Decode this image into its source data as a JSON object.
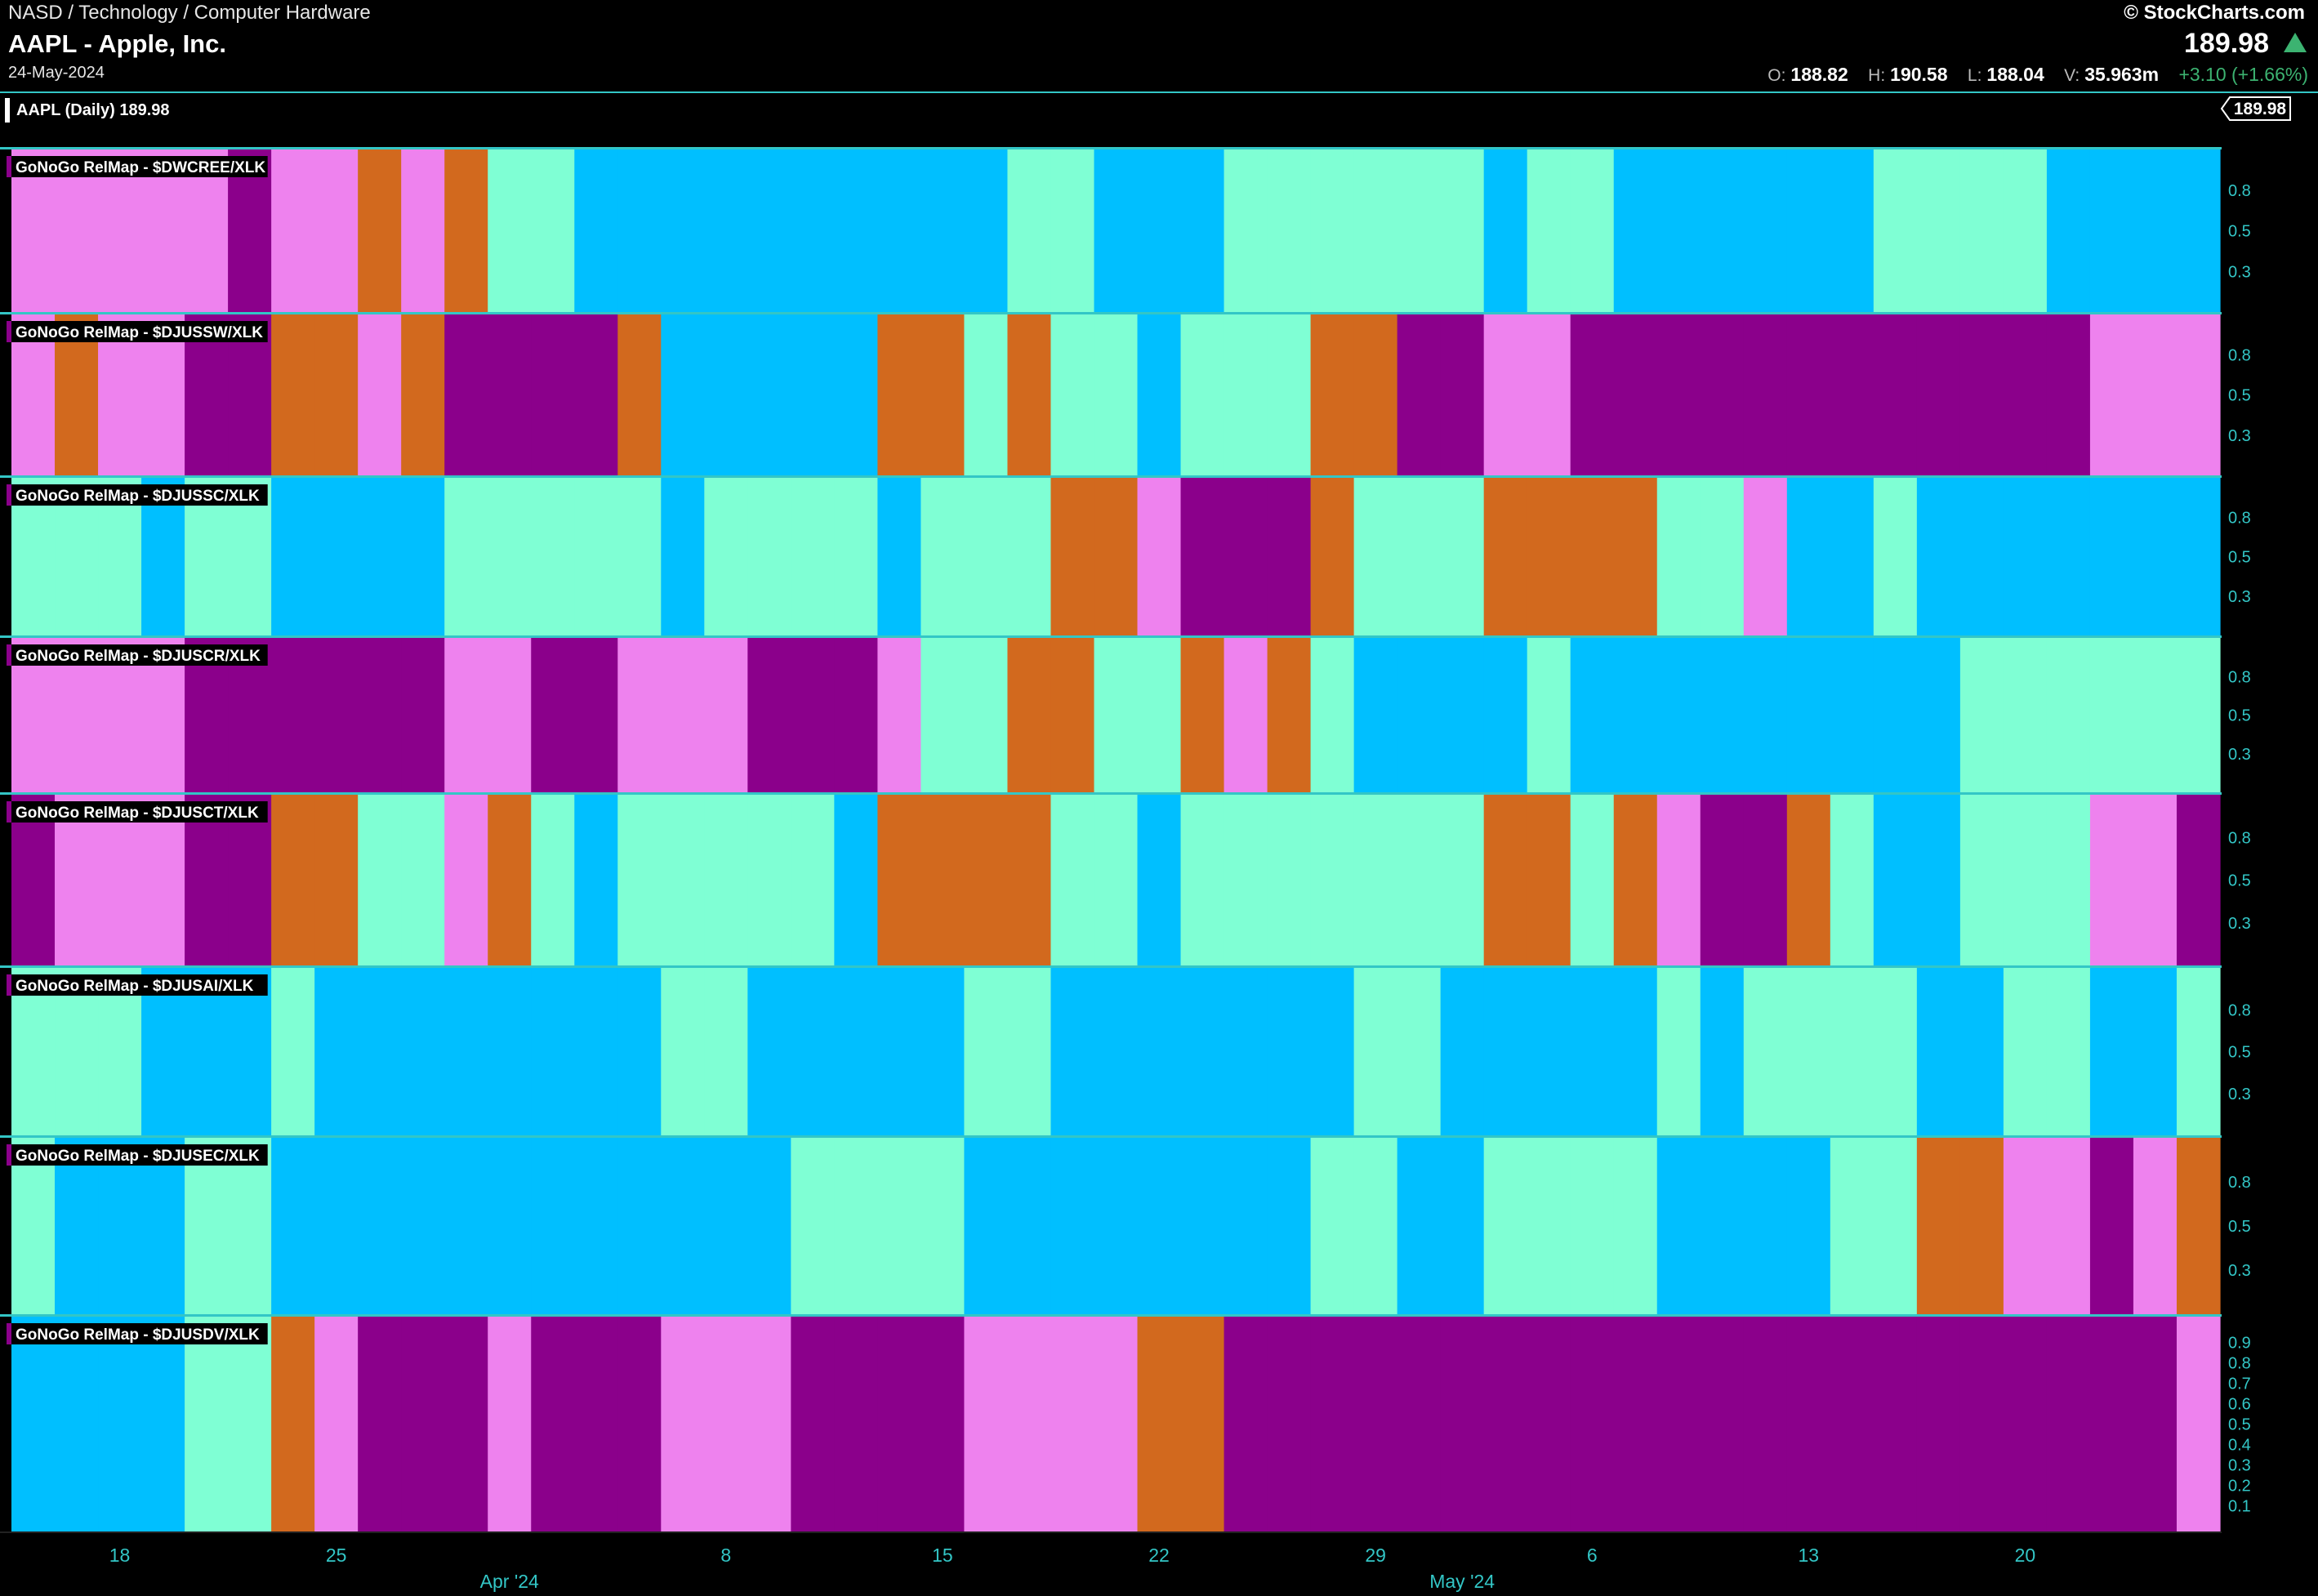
{
  "header": {
    "breadcrumb": "NASD / Technology / Computer Hardware",
    "title": "AAPL - Apple, Inc.",
    "date": "24-May-2024",
    "brand": "© StockCharts.com",
    "price": "189.98",
    "ohlc": {
      "o_label": "O:",
      "o": "188.82",
      "h_label": "H:",
      "h": "190.58",
      "l_label": "L:",
      "l": "188.04",
      "v_label": "V:",
      "v": "35.963m",
      "change": "+3.10 (+1.66%)"
    },
    "change_color": "#3cb371"
  },
  "main_legend": "AAPL (Daily) 189.98",
  "last_price_tag": "189.98",
  "colors": {
    "V": "#ee82ee",
    "P": "#8b008b",
    "O": "#d2691e",
    "A": "#7fffd4",
    "B": "#00bfff",
    "separator": "#33c6c6",
    "axis_text": "#33c6c6"
  },
  "chart_data": {
    "type": "heatmap",
    "color_key_note": "V=violet, P=purple, O=orange, A=aquamarine, B=bright blue",
    "dates": [
      "2024-03-14",
      "2024-03-15",
      "2024-03-18",
      "2024-03-19",
      "2024-03-20",
      "2024-03-21",
      "2024-03-22",
      "2024-03-25",
      "2024-03-26",
      "2024-03-27",
      "2024-03-28",
      "2024-04-01",
      "2024-04-02",
      "2024-04-03",
      "2024-04-04",
      "2024-04-05",
      "2024-04-08",
      "2024-04-09",
      "2024-04-10",
      "2024-04-11",
      "2024-04-12",
      "2024-04-15",
      "2024-04-16",
      "2024-04-17",
      "2024-04-18",
      "2024-04-19",
      "2024-04-22",
      "2024-04-23",
      "2024-04-24",
      "2024-04-25",
      "2024-04-26",
      "2024-04-29",
      "2024-04-30",
      "2024-05-01",
      "2024-05-02",
      "2024-05-03",
      "2024-05-06",
      "2024-05-07",
      "2024-05-08",
      "2024-05-09",
      "2024-05-10",
      "2024-05-13",
      "2024-05-14",
      "2024-05-15",
      "2024-05-16",
      "2024-05-17",
      "2024-05-20",
      "2024-05-21",
      "2024-05-22",
      "2024-05-23",
      "2024-05-24"
    ],
    "x_tick_labels": [
      {
        "date": "2024-03-18",
        "label": "18"
      },
      {
        "date": "2024-03-25",
        "label": "25"
      },
      {
        "date": "2024-04-08",
        "label": "8"
      },
      {
        "date": "2024-04-15",
        "label": "15"
      },
      {
        "date": "2024-04-22",
        "label": "22"
      },
      {
        "date": "2024-04-29",
        "label": "29"
      },
      {
        "date": "2024-05-06",
        "label": "6"
      },
      {
        "date": "2024-05-13",
        "label": "13"
      },
      {
        "date": "2024-05-20",
        "label": "20"
      }
    ],
    "month_labels": [
      {
        "date": "2024-04-01",
        "label": "Apr '24"
      },
      {
        "date": "2024-05-01",
        "label": "May '24"
      }
    ],
    "panels": [
      {
        "name": "GoNoGo RelMap - $DWCREE/XLK",
        "y_ticks": [
          "0.8",
          "0.5",
          "0.3"
        ],
        "colors": "VVVVVPVVOVOAABBBBBBBBBBAABBBAAAAAABAABBBBBBAAAABBBBBB"
      },
      {
        "name": "GoNoGo RelMap - $DJUSSW/XLK",
        "y_ticks": [
          "0.8",
          "0.5",
          "0.3"
        ],
        "colors": "VOVVPPOOVOPPPPOBBBBBOOAOAABAAAOOPPVVPPPPPPPPPPPPVVVP"
      },
      {
        "name": "GoNoGo RelMap - $DJUSSC/XLK",
        "y_ticks": [
          "0.8",
          "0.5",
          "0.3"
        ],
        "colors": "AAABAABBBBAAAAABAAAABAAAOOVPPPOAAAOOOOAAVBBABBBBBBBBB"
      },
      {
        "name": "GoNoGo RelMap - $DJUSCR/XLK",
        "y_ticks": [
          "0.8",
          "0.5",
          "0.3"
        ],
        "colors": "VVVVPPPPPPVVPPVVVPPPVAAOOAAOVOABBBBABBBBBBBBBAAAAAAB"
      },
      {
        "name": "GoNoGo RelMap - $DJUSCT/XLK",
        "y_ticks": [
          "0.8",
          "0.5",
          "0.3"
        ],
        "colors": "PVVVPPOOAAVOABAAAAABOOOOAABAAAAAAAOOAOVPPOABBAAAVVPPP"
      },
      {
        "name": "GoNoGo RelMap - $DJUSAI/XLK",
        "y_ticks": [
          "0.8",
          "0.5",
          "0.3"
        ],
        "colors": "AAABBBABBBBBBBBAABBBBBAABBBBBBBAABBBBBABAAAABBAABBAAB"
      },
      {
        "name": "GoNoGo RelMap - $DJUSEC/XLK",
        "y_ticks": [
          "0.8",
          "0.5",
          "0.3"
        ],
        "colors": "ABBBAABBBBBBBBBBBBAAAABBBBBBBBAABBAAAABBBBAAOOVVPVO"
      },
      {
        "name": "GoNoGo RelMap - $DJUSDV/XLK",
        "y_ticks": [
          "0.9",
          "0.8",
          "0.7",
          "0.6",
          "0.5",
          "0.4",
          "0.3",
          "0.2",
          "0.1"
        ],
        "colors": "BBBBAAOVPPPVPPPVVVPPPPVVVVOOPPPPPPPPPPPPPPPPPPPPPPVVVP"
      }
    ]
  }
}
